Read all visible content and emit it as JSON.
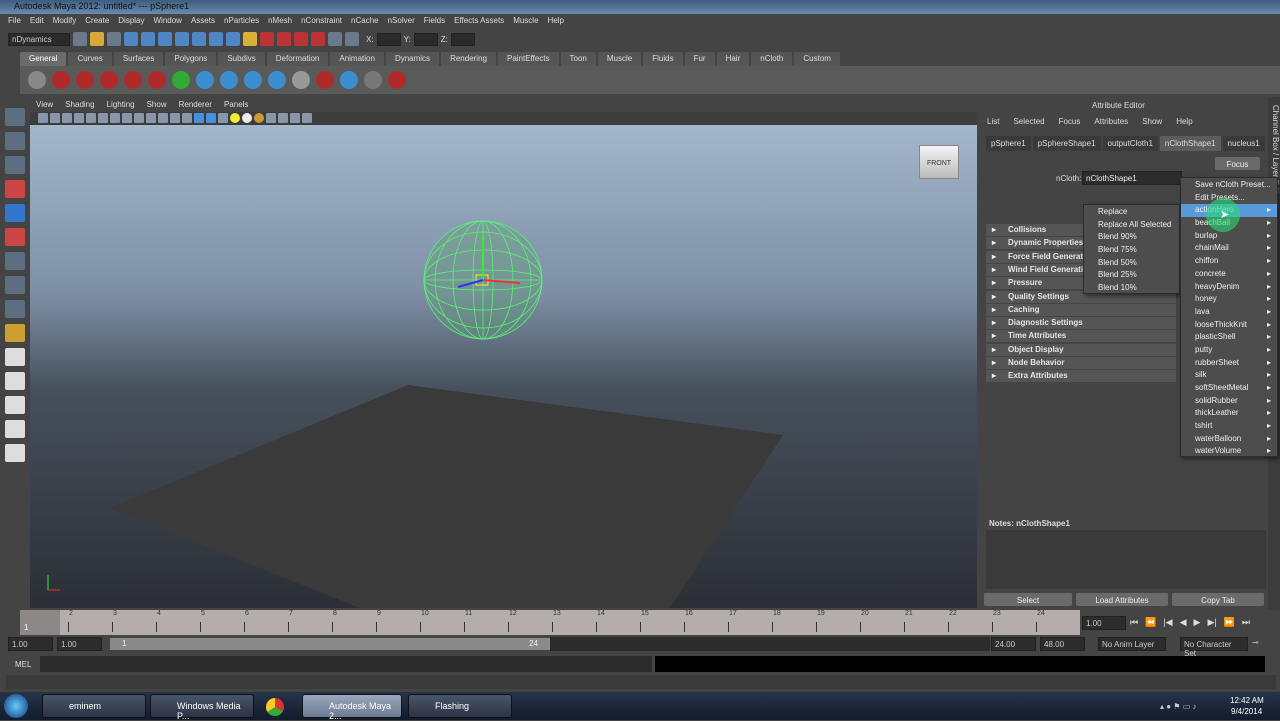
{
  "window": {
    "title": "Autodesk Maya 2012: untitled*  ---  pSphere1"
  },
  "menubar": [
    "File",
    "Edit",
    "Modify",
    "Create",
    "Display",
    "Window",
    "Assets",
    "nParticles",
    "nMesh",
    "nConstraint",
    "nCache",
    "nSolver",
    "Fields",
    "Effects Assets",
    "Muscle",
    "Help"
  ],
  "toolbar": {
    "menuset": "nDynamics",
    "x_label": "X:",
    "y_label": "Y:",
    "z_label": "Z:"
  },
  "shelf_tabs": [
    "General",
    "Curves",
    "Surfaces",
    "Polygons",
    "Subdivs",
    "Deformation",
    "Animation",
    "Dynamics",
    "Rendering",
    "PaintEffects",
    "Toon",
    "Muscle",
    "Fluids",
    "Fur",
    "Hair",
    "nCloth",
    "Custom"
  ],
  "shelf_active": "General",
  "viewport": {
    "menu": [
      "View",
      "Shading",
      "Lighting",
      "Show",
      "Renderer",
      "Panels"
    ],
    "viewcube": "FRONT"
  },
  "attribute_editor": {
    "title": "Attribute Editor",
    "menu": [
      "List",
      "Selected",
      "Focus",
      "Attributes",
      "Show",
      "Help"
    ],
    "tabs": [
      "pSphere1",
      "pSphereShape1",
      "outputCloth1",
      "nClothShape1",
      "nucleus1"
    ],
    "active_tab": "nClothShape1",
    "node_label": "nCloth:",
    "node_value": "nClothShape1",
    "focus_button": "Focus",
    "side_tab": "Channel Box / Layer Editor",
    "sections": [
      "Collisions",
      "Dynamic Properties",
      "Force Field Generation",
      "Wind Field Generation",
      "Pressure",
      "Quality Settings",
      "Caching",
      "Diagnostic Settings",
      "Time Attributes",
      "Object Display",
      "Node Behavior",
      "Extra Attributes"
    ],
    "notes_label": "Notes:  nClothShape1",
    "buttons": [
      "Select",
      "Load Attributes",
      "Copy Tab"
    ]
  },
  "presets_menu": {
    "top": [
      "Save nCloth Preset...",
      "Edit Presets..."
    ],
    "items": [
      "actionHero",
      "beachBall",
      "burlap",
      "chainMail",
      "chiffon",
      "concrete",
      "heavyDenim",
      "honey",
      "lava",
      "looseThickKnit",
      "plasticShell",
      "putty",
      "rubberSheet",
      "silk",
      "softSheetMetal",
      "solidRubber",
      "thickLeather",
      "tshirt",
      "waterBalloon",
      "waterVolume"
    ],
    "highlighted": "actionHero"
  },
  "blend_submenu": [
    "Replace",
    "Replace All Selected",
    "Blend 90%",
    "Blend 75%",
    "Blend 50%",
    "Blend 25%",
    "Blend 10%"
  ],
  "timeline": {
    "ticks": [
      "1",
      "2",
      "3",
      "4",
      "5",
      "6",
      "7",
      "8",
      "9",
      "10",
      "11",
      "12",
      "13",
      "14",
      "15",
      "16",
      "17",
      "18",
      "19",
      "20",
      "21",
      "22",
      "23",
      "24"
    ],
    "current_frame": "1",
    "current_time": "1.00"
  },
  "range": {
    "start": "1.00",
    "playback_start": "1.00",
    "slider_start": "1",
    "slider_end": "24",
    "playback_end": "24.00",
    "end": "48.00",
    "anim_layer": "No Anim Layer",
    "character_set": "No Character Set"
  },
  "command_line": {
    "label": "MEL"
  },
  "taskbar": {
    "items": [
      "eminem",
      "Windows Media P...",
      "Autodesk Maya 2...",
      "Flashing"
    ],
    "time": "12:42 AM",
    "date": "9/4/2014"
  }
}
